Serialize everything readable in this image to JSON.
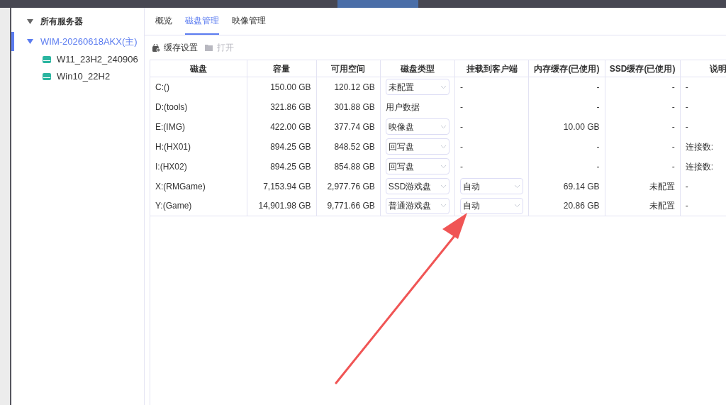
{
  "sidebar": {
    "root": {
      "label": "所有服务器",
      "expanded": true,
      "children": [
        {
          "label": "WIM-20260618AKX(主)",
          "expanded": true,
          "selected": true,
          "children": [
            {
              "label": "W11_23H2_240906",
              "selected": false
            },
            {
              "label": "Win10_22H2",
              "selected": false
            }
          ]
        }
      ]
    }
  },
  "tabs": [
    {
      "label": "概览",
      "selected": false
    },
    {
      "label": "磁盘管理",
      "selected": true
    },
    {
      "label": "映像管理",
      "selected": false
    }
  ],
  "toolbar": [
    {
      "label": "缓存设置",
      "disabled": false
    },
    {
      "label": "打开",
      "disabled": true
    }
  ],
  "table": {
    "columns": [
      "磁盘",
      "容量",
      "可用空间",
      "磁盘类型",
      "挂载到客户端",
      "内存缓存(已使用)",
      "SSD缓存(已使用)",
      "说明"
    ],
    "rows": [
      [
        {
          "kind": "text",
          "text": "C:()"
        },
        {
          "kind": "text",
          "text": "150.00 GB"
        },
        {
          "kind": "text",
          "text": "120.12 GB"
        },
        {
          "kind": "select",
          "text": "未配置"
        },
        {
          "kind": "text",
          "text": "-"
        },
        {
          "kind": "text",
          "text": "-"
        },
        {
          "kind": "text",
          "text": "-"
        },
        {
          "kind": "text",
          "text": "-"
        }
      ],
      [
        {
          "kind": "text",
          "text": "D:(tools)"
        },
        {
          "kind": "text",
          "text": "321.86 GB"
        },
        {
          "kind": "text",
          "text": "301.88 GB"
        },
        {
          "kind": "text",
          "text": "用户数据"
        },
        {
          "kind": "text",
          "text": "-"
        },
        {
          "kind": "text",
          "text": "-"
        },
        {
          "kind": "text",
          "text": "-"
        },
        {
          "kind": "text",
          "text": "-"
        }
      ],
      [
        {
          "kind": "text",
          "text": "E:(IMG)"
        },
        {
          "kind": "text",
          "text": "422.00 GB"
        },
        {
          "kind": "text",
          "text": "377.74 GB"
        },
        {
          "kind": "select",
          "text": "映像盘"
        },
        {
          "kind": "text",
          "text": "-"
        },
        {
          "kind": "text",
          "text": "10.00 GB"
        },
        {
          "kind": "text",
          "text": "-"
        },
        {
          "kind": "text",
          "text": "-"
        }
      ],
      [
        {
          "kind": "text",
          "text": "H:(HX01)"
        },
        {
          "kind": "text",
          "text": "894.25 GB"
        },
        {
          "kind": "text",
          "text": "848.52 GB"
        },
        {
          "kind": "select",
          "text": "回写盘"
        },
        {
          "kind": "text",
          "text": "-"
        },
        {
          "kind": "text",
          "text": "-"
        },
        {
          "kind": "text",
          "text": "-"
        },
        {
          "kind": "text",
          "text": "连接数:"
        }
      ],
      [
        {
          "kind": "text",
          "text": "I:(HX02)"
        },
        {
          "kind": "text",
          "text": "894.25 GB"
        },
        {
          "kind": "text",
          "text": "854.88 GB"
        },
        {
          "kind": "select",
          "text": "回写盘"
        },
        {
          "kind": "text",
          "text": "-"
        },
        {
          "kind": "text",
          "text": "-"
        },
        {
          "kind": "text",
          "text": "-"
        },
        {
          "kind": "text",
          "text": "连接数:"
        }
      ],
      [
        {
          "kind": "text",
          "text": "X:(RMGame)"
        },
        {
          "kind": "text",
          "text": "7,153.94 GB"
        },
        {
          "kind": "text",
          "text": "2,977.76 GB"
        },
        {
          "kind": "select",
          "text": "SSD游戏盘"
        },
        {
          "kind": "select",
          "text": "自动"
        },
        {
          "kind": "text",
          "text": "69.14 GB"
        },
        {
          "kind": "text",
          "text": "未配置"
        },
        {
          "kind": "text",
          "text": "-"
        }
      ],
      [
        {
          "kind": "text",
          "text": "Y:(Game)"
        },
        {
          "kind": "text",
          "text": "14,901.98 GB"
        },
        {
          "kind": "text",
          "text": "9,771.66 GB"
        },
        {
          "kind": "select",
          "text": "普通游戏盘"
        },
        {
          "kind": "select",
          "text": "自动"
        },
        {
          "kind": "text",
          "text": "20.86 GB"
        },
        {
          "kind": "text",
          "text": "未配置"
        },
        {
          "kind": "text",
          "text": "-"
        }
      ]
    ]
  }
}
